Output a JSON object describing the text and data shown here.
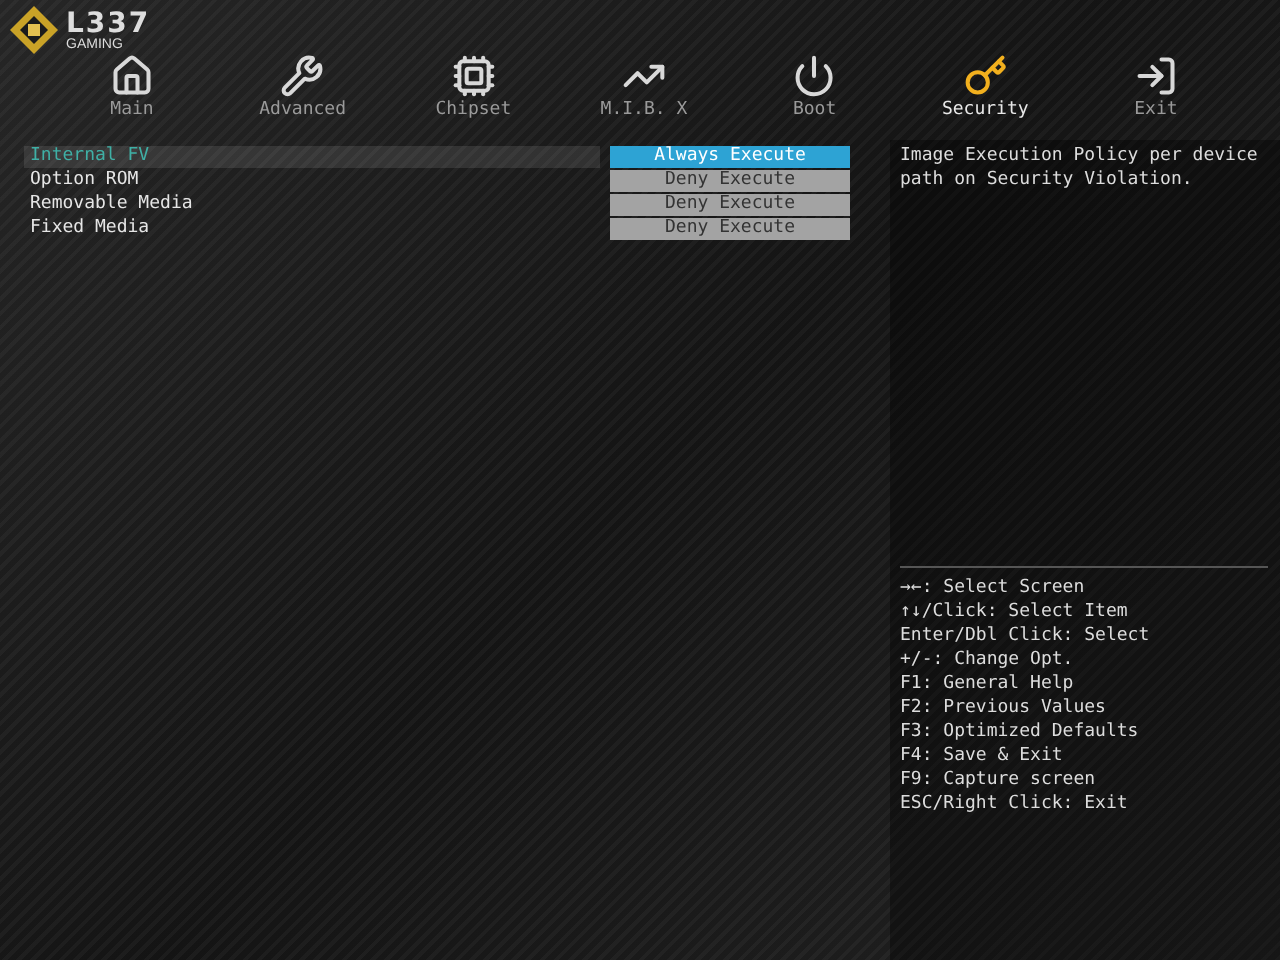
{
  "logo": {
    "title": "L337",
    "subtitle": "GAMING"
  },
  "tabs": [
    {
      "label": "Main",
      "kind": "home",
      "selected": false
    },
    {
      "label": "Advanced",
      "kind": "tool",
      "selected": false
    },
    {
      "label": "Chipset",
      "kind": "chip",
      "selected": false
    },
    {
      "label": "M.I.B. X",
      "kind": "chart",
      "selected": false
    },
    {
      "label": "Boot",
      "kind": "power",
      "selected": false
    },
    {
      "label": "Security",
      "kind": "key",
      "selected": true
    },
    {
      "label": "Exit",
      "kind": "exit",
      "selected": false
    }
  ],
  "settings": [
    {
      "label": "Internal FV",
      "value": "Always Execute",
      "selected": true
    },
    {
      "label": "Option ROM",
      "value": "Deny Execute",
      "selected": false
    },
    {
      "label": "Removable Media",
      "value": "Deny Execute",
      "selected": false
    },
    {
      "label": "Fixed Media",
      "value": "Deny Execute",
      "selected": false
    }
  ],
  "help_text": "Image Execution Policy per device path on Security Violation.",
  "hotkeys": [
    "→←: Select Screen",
    "↑↓/Click: Select Item",
    "Enter/Dbl Click: Select",
    "+/-: Change Opt.",
    "F1: General Help",
    "F2: Previous Values",
    "F3: Optimized Defaults",
    "F4: Save & Exit",
    "F9: Capture screen",
    "ESC/Right Click: Exit"
  ]
}
